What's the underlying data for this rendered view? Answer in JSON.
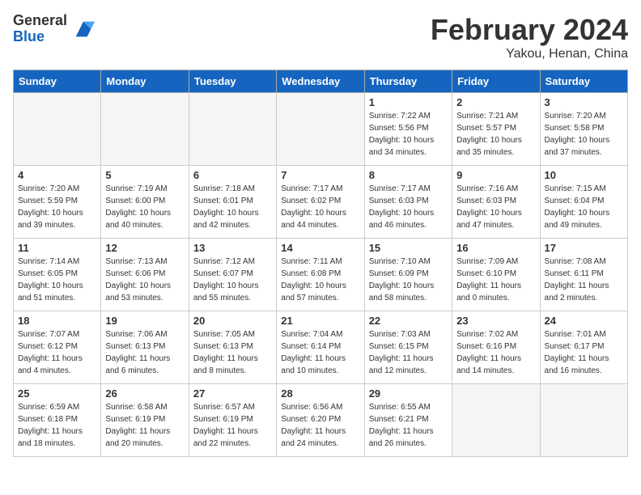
{
  "header": {
    "logo_general": "General",
    "logo_blue": "Blue",
    "title": "February 2024",
    "location": "Yakou, Henan, China"
  },
  "weekdays": [
    "Sunday",
    "Monday",
    "Tuesday",
    "Wednesday",
    "Thursday",
    "Friday",
    "Saturday"
  ],
  "weeks": [
    [
      {
        "day": "",
        "empty": true
      },
      {
        "day": "",
        "empty": true
      },
      {
        "day": "",
        "empty": true
      },
      {
        "day": "",
        "empty": true
      },
      {
        "day": "1",
        "sunrise": "7:22 AM",
        "sunset": "5:56 PM",
        "daylight": "10 hours and 34 minutes."
      },
      {
        "day": "2",
        "sunrise": "7:21 AM",
        "sunset": "5:57 PM",
        "daylight": "10 hours and 35 minutes."
      },
      {
        "day": "3",
        "sunrise": "7:20 AM",
        "sunset": "5:58 PM",
        "daylight": "10 hours and 37 minutes."
      }
    ],
    [
      {
        "day": "4",
        "sunrise": "7:20 AM",
        "sunset": "5:59 PM",
        "daylight": "10 hours and 39 minutes."
      },
      {
        "day": "5",
        "sunrise": "7:19 AM",
        "sunset": "6:00 PM",
        "daylight": "10 hours and 40 minutes."
      },
      {
        "day": "6",
        "sunrise": "7:18 AM",
        "sunset": "6:01 PM",
        "daylight": "10 hours and 42 minutes."
      },
      {
        "day": "7",
        "sunrise": "7:17 AM",
        "sunset": "6:02 PM",
        "daylight": "10 hours and 44 minutes."
      },
      {
        "day": "8",
        "sunrise": "7:17 AM",
        "sunset": "6:03 PM",
        "daylight": "10 hours and 46 minutes."
      },
      {
        "day": "9",
        "sunrise": "7:16 AM",
        "sunset": "6:03 PM",
        "daylight": "10 hours and 47 minutes."
      },
      {
        "day": "10",
        "sunrise": "7:15 AM",
        "sunset": "6:04 PM",
        "daylight": "10 hours and 49 minutes."
      }
    ],
    [
      {
        "day": "11",
        "sunrise": "7:14 AM",
        "sunset": "6:05 PM",
        "daylight": "10 hours and 51 minutes."
      },
      {
        "day": "12",
        "sunrise": "7:13 AM",
        "sunset": "6:06 PM",
        "daylight": "10 hours and 53 minutes."
      },
      {
        "day": "13",
        "sunrise": "7:12 AM",
        "sunset": "6:07 PM",
        "daylight": "10 hours and 55 minutes."
      },
      {
        "day": "14",
        "sunrise": "7:11 AM",
        "sunset": "6:08 PM",
        "daylight": "10 hours and 57 minutes."
      },
      {
        "day": "15",
        "sunrise": "7:10 AM",
        "sunset": "6:09 PM",
        "daylight": "10 hours and 58 minutes."
      },
      {
        "day": "16",
        "sunrise": "7:09 AM",
        "sunset": "6:10 PM",
        "daylight": "11 hours and 0 minutes."
      },
      {
        "day": "17",
        "sunrise": "7:08 AM",
        "sunset": "6:11 PM",
        "daylight": "11 hours and 2 minutes."
      }
    ],
    [
      {
        "day": "18",
        "sunrise": "7:07 AM",
        "sunset": "6:12 PM",
        "daylight": "11 hours and 4 minutes."
      },
      {
        "day": "19",
        "sunrise": "7:06 AM",
        "sunset": "6:13 PM",
        "daylight": "11 hours and 6 minutes."
      },
      {
        "day": "20",
        "sunrise": "7:05 AM",
        "sunset": "6:13 PM",
        "daylight": "11 hours and 8 minutes."
      },
      {
        "day": "21",
        "sunrise": "7:04 AM",
        "sunset": "6:14 PM",
        "daylight": "11 hours and 10 minutes."
      },
      {
        "day": "22",
        "sunrise": "7:03 AM",
        "sunset": "6:15 PM",
        "daylight": "11 hours and 12 minutes."
      },
      {
        "day": "23",
        "sunrise": "7:02 AM",
        "sunset": "6:16 PM",
        "daylight": "11 hours and 14 minutes."
      },
      {
        "day": "24",
        "sunrise": "7:01 AM",
        "sunset": "6:17 PM",
        "daylight": "11 hours and 16 minutes."
      }
    ],
    [
      {
        "day": "25",
        "sunrise": "6:59 AM",
        "sunset": "6:18 PM",
        "daylight": "11 hours and 18 minutes."
      },
      {
        "day": "26",
        "sunrise": "6:58 AM",
        "sunset": "6:19 PM",
        "daylight": "11 hours and 20 minutes."
      },
      {
        "day": "27",
        "sunrise": "6:57 AM",
        "sunset": "6:19 PM",
        "daylight": "11 hours and 22 minutes."
      },
      {
        "day": "28",
        "sunrise": "6:56 AM",
        "sunset": "6:20 PM",
        "daylight": "11 hours and 24 minutes."
      },
      {
        "day": "29",
        "sunrise": "6:55 AM",
        "sunset": "6:21 PM",
        "daylight": "11 hours and 26 minutes."
      },
      {
        "day": "",
        "empty": true
      },
      {
        "day": "",
        "empty": true
      }
    ]
  ]
}
